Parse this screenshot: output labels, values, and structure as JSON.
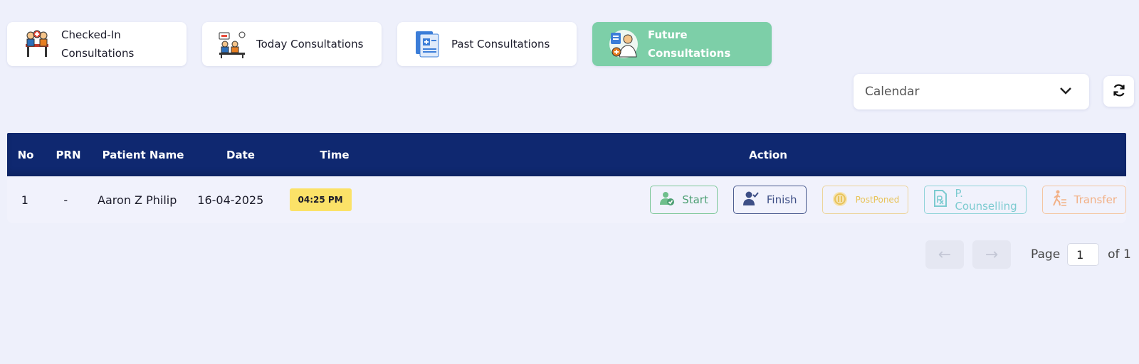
{
  "tabs": [
    {
      "label": "Checked-In Consultations",
      "icon": "checkin-icon"
    },
    {
      "label": "Today Consultations",
      "icon": "waiting-room-icon"
    },
    {
      "label": "Past Consultations",
      "icon": "medical-records-icon"
    },
    {
      "label": "Future Consultations",
      "icon": "doctor-icon"
    }
  ],
  "filter": {
    "selected": "Calendar"
  },
  "table": {
    "headers": {
      "no": "No",
      "prn": "PRN",
      "name": "Patient Name",
      "date": "Date",
      "time": "Time",
      "action": "Action"
    },
    "rows": [
      {
        "no": "1",
        "prn": "-",
        "name": "Aaron Z Philip",
        "date": "16-04-2025",
        "time": "04:25 PM"
      }
    ]
  },
  "actions": {
    "start": "Start",
    "finish": "Finish",
    "postponed": "PostPoned",
    "counselling": "P. Counselling",
    "transfer": "Transfer"
  },
  "pagination": {
    "prev": "←",
    "next": "→",
    "page_label": "Page",
    "current_page": "1",
    "of_label": "of 1"
  },
  "colors": {
    "header_bg": "#0f2870",
    "active_tab": "#7dcfa8",
    "time_badge": "#fbe268"
  }
}
